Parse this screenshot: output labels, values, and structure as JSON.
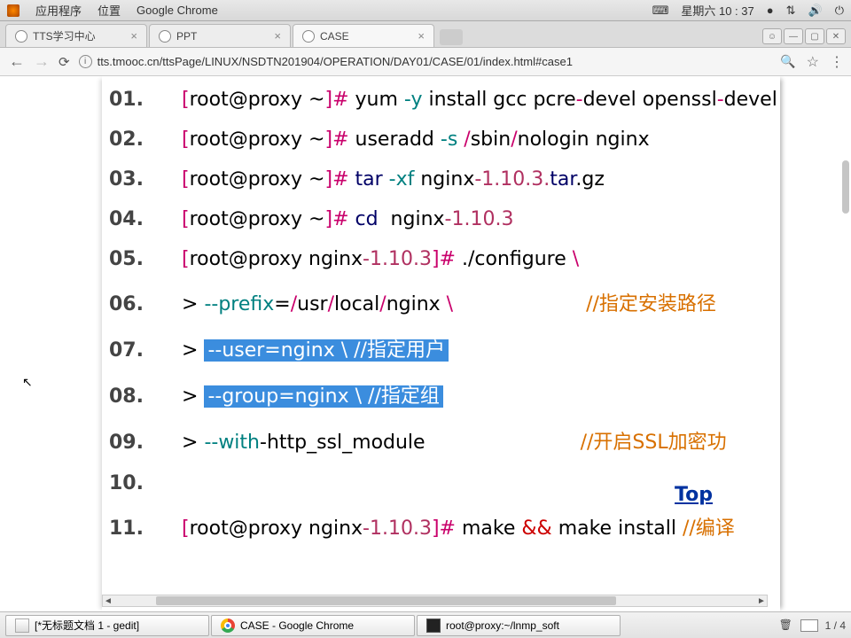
{
  "sysbar": {
    "apps": "应用程序",
    "places": "位置",
    "active_app": "Google Chrome",
    "date": "星期六 10 : 37",
    "dot": "●"
  },
  "tabs": [
    {
      "label": "TTS学习中心"
    },
    {
      "label": "PPT"
    },
    {
      "label": "CASE",
      "active": true
    }
  ],
  "address": {
    "url": "tts.tmooc.cn/ttsPage/LINUX/NSDTN201904/OPERATION/DAY01/CASE/01/index.html#case1"
  },
  "lines": {
    "l01": {
      "n": "01.",
      "p": "root@proxy ~",
      "cmd": "yum ",
      "flag": "-y",
      "rest": " install gcc pcre",
      "rest2": "devel openssl",
      "rest3": "devel"
    },
    "l02": {
      "n": "02.",
      "p": "root@proxy ~",
      "cmd": "useradd ",
      "flag": "-s ",
      "path": "/sbin/nologin",
      "a": " nginx"
    },
    "l03": {
      "n": "03.",
      "p": "root@proxy ~",
      "cmd": "tar  ",
      "flag": "-xf",
      "sp": "   nginx",
      "v": "-1.10.3.",
      "ext": "tar.gz"
    },
    "l04": {
      "n": "04.",
      "p": "root@proxy ~",
      "cmd": "cd  nginx",
      "v": "-1.10.3"
    },
    "l05": {
      "n": "05.",
      "p": "root@proxy nginx",
      "pv": "-1.10.3",
      "cmd": " ./configure   ",
      "cont": "\\"
    },
    "l06": {
      "n": "06.",
      "gt": "> ",
      "a": "--prefix",
      "eq": "=",
      "path": "/usr/local/nginx",
      "sp": "   ",
      "cont": "\\",
      "cm": "//指定安装路径"
    },
    "l07": {
      "n": "07.",
      "gt": "> ",
      "sel_a": "--user=nginx   ",
      "sel_cont": "\\",
      "sel_gap": "                       ",
      "cm": "//指定用户"
    },
    "l08": {
      "n": "08.",
      "gt": "> ",
      "sel_a": "--group=nginx  ",
      "sel_cont": "\\",
      "sel_gap": "                        ",
      "cm": "//指定组"
    },
    "l09": {
      "n": "09.",
      "gt": "> ",
      "a": "--with",
      "rest": "-http_ssl_module",
      "cm": "//开启SSL加密功"
    },
    "l10": {
      "n": "10."
    },
    "l11": {
      "n": "11.",
      "p": "root@proxy nginx",
      "pv": "-1.10.3",
      "cmd": " make ",
      "amp": "&& ",
      "rest": "make install   ",
      "cm": "//编译"
    }
  },
  "toplink": "Top",
  "taskbar": {
    "t1": "[*无标题文档 1 - gedit]",
    "t2": "CASE - Google Chrome",
    "t3": "root@proxy:~/lnmp_soft",
    "ws": "1 / 4"
  }
}
